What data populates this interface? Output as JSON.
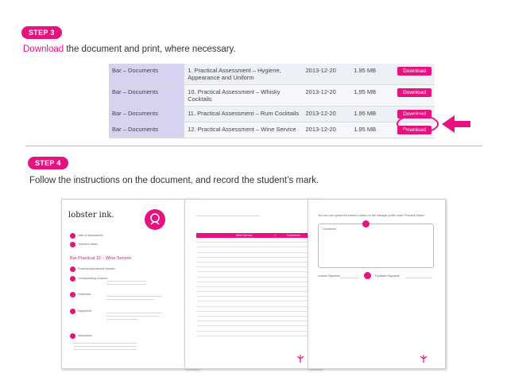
{
  "step3": {
    "badge": "STEP 3",
    "instruction_link": "Download",
    "instruction_rest": " the document and print, where necessary."
  },
  "documents": [
    {
      "category": "Bar – Documents",
      "title": "1. Practical Assessment – Hygiene, Appearance and Uniform",
      "date": "2013-12-20",
      "size": "1.95 MB",
      "action": "Download"
    },
    {
      "category": "Bar – Documents",
      "title": "10. Practical Assessment – Whisky Cocktails",
      "date": "2013-12-20",
      "size": "1.95 MB",
      "action": "Download"
    },
    {
      "category": "Bar – Documents",
      "title": "11. Practical Assessment – Rum Cocktails",
      "date": "2013-12-20",
      "size": "1.95 MB",
      "action": "Download"
    },
    {
      "category": "Bar – Documents",
      "title": "12. Practical Assessment – Wine Service",
      "date": "2013-12-20",
      "size": "1.95 MB",
      "action": "Download"
    }
  ],
  "step4": {
    "badge": "STEP 4",
    "instruction": "Follow the instructions on the document, and record the student’s mark."
  },
  "thumbnails": {
    "page1": {
      "logo": "lobster ink.",
      "title": "Bar Practical 12 – Wine Service",
      "fields": [
        "Date of Assessment:",
        "Learner's Name:"
      ],
      "sections": [
        "Practical Assessment Number:",
        "Corresponding Lessons:",
        "Outcomes:",
        "Equipment:",
        "Instructions:"
      ]
    },
    "page2": {
      "table_headers": [
        "Wine Service",
        "✓",
        "Comments"
      ]
    },
    "page3": {
      "heading": "You can now upload the learner's marks on the manager profile under 'Practical Marks'",
      "box_label": "Comments",
      "sign_left": "Learner Signature",
      "sign_right": "Facilitator Signature"
    },
    "accent": "#e6127f"
  }
}
